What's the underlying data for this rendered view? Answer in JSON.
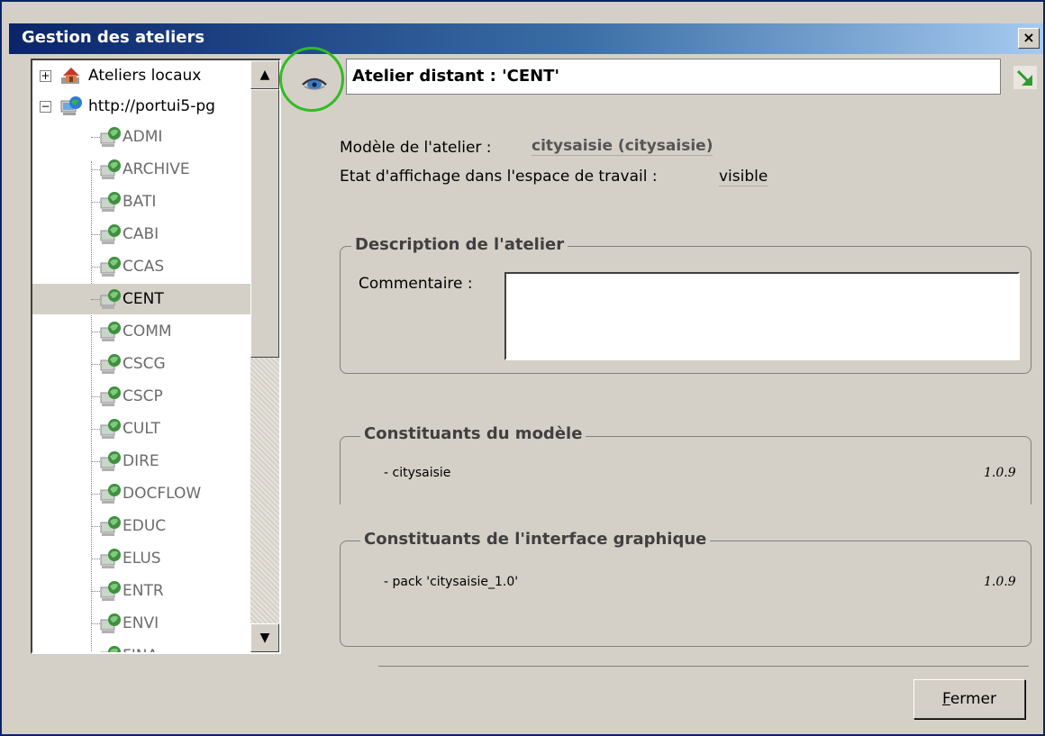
{
  "window": {
    "title": "Gestion des ateliers",
    "close_glyph": "×"
  },
  "tree": {
    "root_local": {
      "label": "Ateliers locaux",
      "expander": "+"
    },
    "root_remote": {
      "label": "http://portui5-pg",
      "expander": "−"
    },
    "children": [
      {
        "label": "ADMI"
      },
      {
        "label": "ARCHIVE"
      },
      {
        "label": "BATI"
      },
      {
        "label": "CABI"
      },
      {
        "label": "CCAS"
      },
      {
        "label": "CENT",
        "selected": true
      },
      {
        "label": "COMM"
      },
      {
        "label": "CSCG"
      },
      {
        "label": "CSCP"
      },
      {
        "label": "CULT"
      },
      {
        "label": "DIRE"
      },
      {
        "label": "DOCFLOW"
      },
      {
        "label": "EDUC"
      },
      {
        "label": "ELUS"
      },
      {
        "label": "ENTR"
      },
      {
        "label": "ENVI"
      },
      {
        "label": "FINA"
      }
    ],
    "scroll_up": "▲",
    "scroll_down": "▼"
  },
  "header": {
    "title": "Atelier distant : 'CENT'"
  },
  "info": {
    "modele_label": "Modèle de l'atelier :",
    "modele_value": "citysaisie (citysaisie)",
    "etat_label": "Etat d'affichage dans l'espace de travail :",
    "etat_value": "visible"
  },
  "description": {
    "title": "Description de l'atelier",
    "comment_label": "Commentaire :",
    "comment_value": ""
  },
  "constituants_modele": {
    "title": "Constituants du modèle",
    "rows": [
      {
        "name": "- citysaisie",
        "version": "1.0.9"
      }
    ]
  },
  "constituants_interface": {
    "title": "Constituants de l'interface graphique",
    "rows": [
      {
        "name": "- pack 'citysaisie_1.0'",
        "version": "1.0.9"
      }
    ]
  },
  "buttons": {
    "fermer": "Fermer"
  },
  "icons": {
    "eye": "eye-icon",
    "go": "arrow-go-icon",
    "local_root": "house-icon",
    "remote_root": "globe-computer-icon",
    "atelier": "globe-computer-icon"
  },
  "colors": {
    "titlebar_start": "#0a246a",
    "titlebar_end": "#a6caf0",
    "highlight_circle": "#33bb22",
    "background": "#d4d0c8"
  }
}
